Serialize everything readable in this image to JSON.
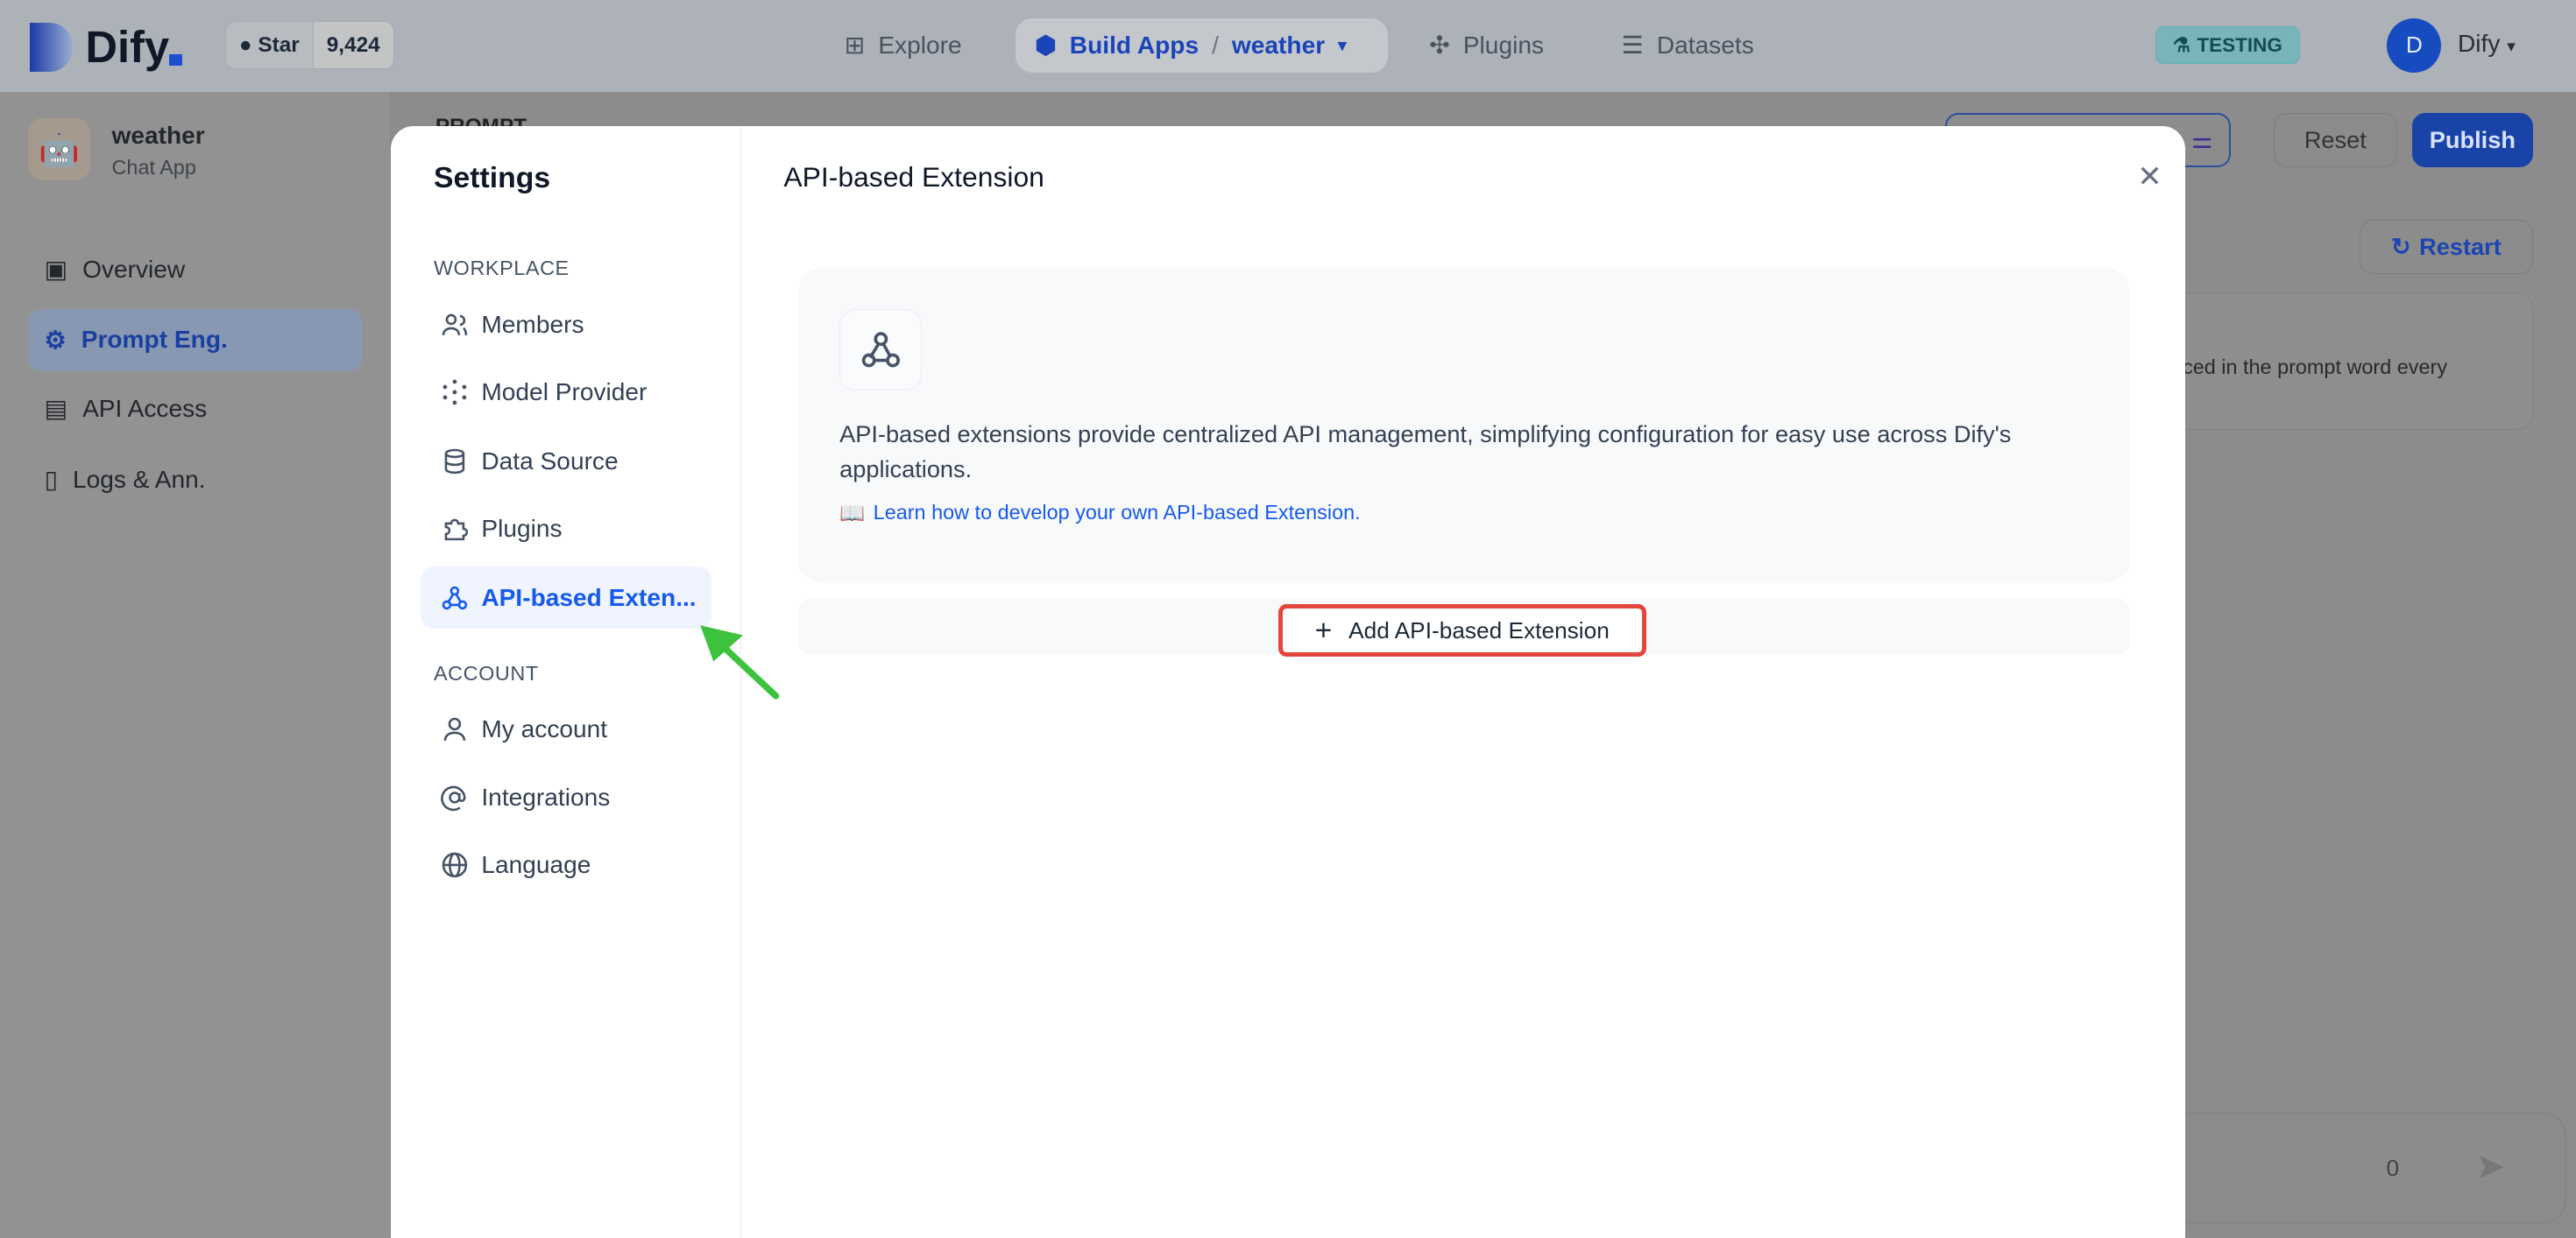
{
  "header": {
    "brand": "Dify",
    "github": {
      "star_label": "Star",
      "count": "9,424"
    },
    "nav": [
      {
        "label": "Explore"
      },
      {
        "label": "Build Apps"
      },
      {
        "label": "Plugins"
      },
      {
        "label": "Datasets"
      }
    ],
    "breadcrumb_sep": "/",
    "current_app": "weather",
    "env_badge": "TESTING",
    "user": {
      "initial": "D",
      "name": "Dify"
    }
  },
  "app_sidebar": {
    "app_name": "weather",
    "app_type": "Chat App",
    "items": [
      {
        "label": "Overview"
      },
      {
        "label": "Prompt Eng."
      },
      {
        "label": "API Access"
      },
      {
        "label": "Logs & Ann."
      }
    ]
  },
  "page": {
    "section_label": "PROMPT",
    "reset": "Reset",
    "publish": "Publish",
    "restart": "Restart",
    "card_text": "ced in the prompt word every",
    "char_count": "0"
  },
  "modal": {
    "title": "Settings",
    "workplace_label": "WORKPLACE",
    "account_label": "ACCOUNT",
    "workplace_items": [
      {
        "label": "Members"
      },
      {
        "label": "Model Provider"
      },
      {
        "label": "Data Source"
      },
      {
        "label": "Plugins"
      },
      {
        "label": "API-based Exten..."
      }
    ],
    "account_items": [
      {
        "label": "My account"
      },
      {
        "label": "Integrations"
      },
      {
        "label": "Language"
      }
    ],
    "content": {
      "heading": "API-based Extension",
      "close": "✕",
      "description": "API-based extensions provide centralized API management, simplifying configuration for easy use across Dify's applications.",
      "learn_link": "Learn how to develop your own API-based Extension.",
      "add_button": "Add API-based Extension"
    }
  },
  "colors": {
    "accent": "#155aef",
    "highlight": "#e5453f",
    "arrow": "#3cc23c"
  }
}
